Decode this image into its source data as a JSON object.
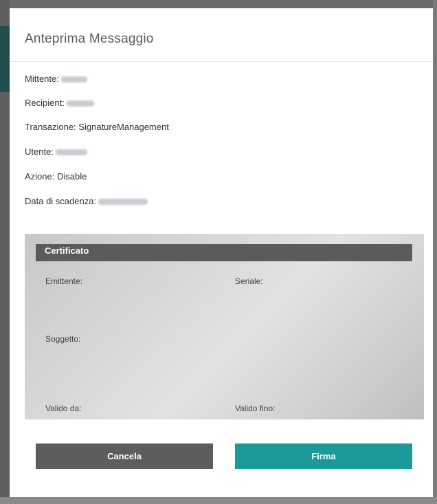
{
  "dialog": {
    "title": "Anteprima Messaggio"
  },
  "info": {
    "mittente_label": "Mittente:",
    "recipient_label": "Recipient:",
    "transazione_label": "Transazione:",
    "transazione_value": "SignatureManagement",
    "utente_label": "Utente:",
    "azione_label": "Azione:",
    "azione_value": "Disable",
    "scadenza_label": "Data di scadenza:"
  },
  "certificate": {
    "title": "Certificato",
    "emittente_label": "Emittente:",
    "seriale_label": "Seriale:",
    "soggetto_label": "Soggetto:",
    "valido_da_label": "Valido da:",
    "valido_fino_label": "Valido fino:"
  },
  "buttons": {
    "cancel_label": "Cancela",
    "sign_label": "Firma"
  },
  "colors": {
    "cancel_button": "#5d5d5d",
    "sign_button": "#1a9a9a",
    "certificate_header": "#5b5b5b"
  }
}
